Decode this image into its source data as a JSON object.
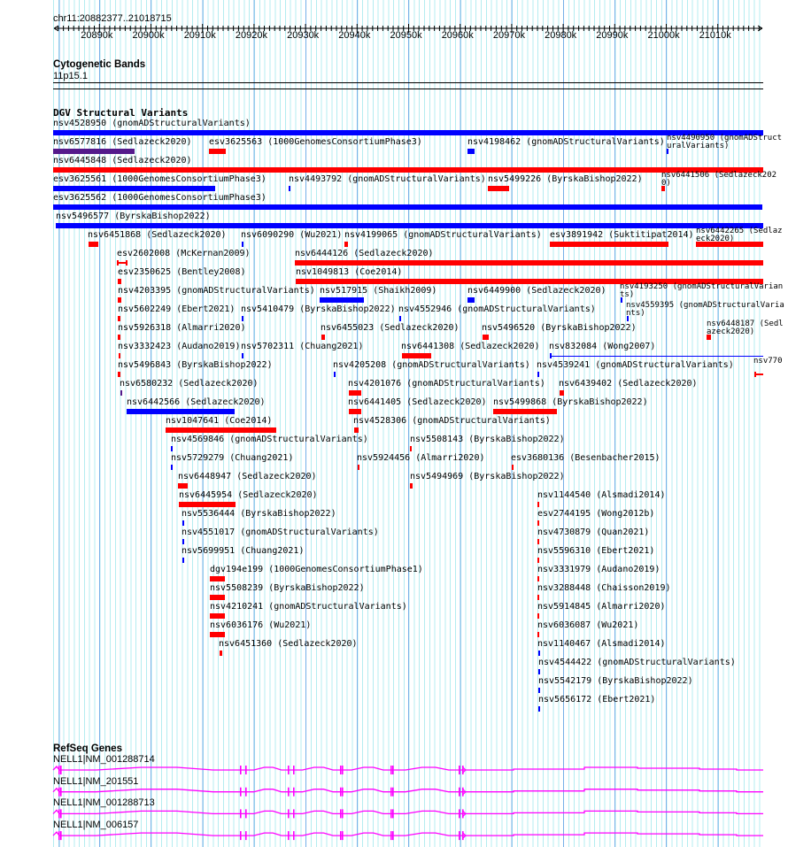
{
  "ruler": {
    "location": "chr11:20882377..21018715",
    "tick_labels": [
      "20890k",
      "20900k",
      "20910k",
      "20920k",
      "20930k",
      "20940k",
      "20950k",
      "20960k",
      "20970k",
      "20980k",
      "20990k",
      "21000k",
      "21010k"
    ]
  },
  "cytogenetic": {
    "title": "Cytogenetic Bands",
    "band": "11p15.1"
  },
  "dgv": {
    "title": "DGV Structural Variants",
    "colors": {
      "gain": "#0000ff",
      "loss": "#ff0000",
      "both": "#551a8b"
    },
    "features": [
      {
        "label": "nsv4528950 (gnomADStructuralVariants)",
        "color": "#0000ff"
      },
      {
        "label": "nsv6577816 (Sedlazeck2020)",
        "color": "#551a8b"
      },
      {
        "label": "esv3625563 (1000GenomesConsortiumPhase3)",
        "color": "#ff0000"
      },
      {
        "label": "nsv4198462 (gnomADStructuralVariants)",
        "color": "#0000ff"
      },
      {
        "label": "nsv4490950 (gnomADStructuralVariants)",
        "color": "#0000ff"
      },
      {
        "label": "nsv6445848 (Sedlazeck2020)",
        "color": "#ff0000"
      },
      {
        "label": "esv3625561 (1000GenomesConsortiumPhase3)",
        "color": "#0000ff"
      },
      {
        "label": "nsv4493792 (gnomADStructuralVariants)",
        "color": "#0000ff"
      },
      {
        "label": "nsv5499226 (ByrskaBishop2022)",
        "color": "#ff0000"
      },
      {
        "label": "nsv6441506 (Sedlazeck2020)",
        "color": "#ff0000"
      },
      {
        "label": "esv3625562 (1000GenomesConsortiumPhase3)",
        "color": "#0000ff"
      },
      {
        "label": "nsv5496577 (ByrskaBishop2022)",
        "color": "#0000ff"
      },
      {
        "label": "nsv6451868 (Sedlazeck2020)",
        "color": "#ff0000"
      },
      {
        "label": "nsv6090290 (Wu2021)",
        "color": "#0000ff"
      },
      {
        "label": "nsv4199065 (gnomADStructuralVariants)",
        "color": "#ff0000"
      },
      {
        "label": "esv3891942 (Suktitipat2014)",
        "color": "#ff0000"
      },
      {
        "label": "nsv6442265 (Sedlazeck2020)",
        "color": "#ff0000"
      },
      {
        "label": "esv2602008 (McKernan2009)",
        "color": "#ff0000"
      },
      {
        "label": "nsv6444126 (Sedlazeck2020)",
        "color": "#ff0000"
      },
      {
        "label": "esv2350625 (Bentley2008)",
        "color": "#ff0000"
      },
      {
        "label": "nsv1049813 (Coe2014)",
        "color": "#ff0000"
      },
      {
        "label": "nsv4203395 (gnomADStructuralVariants)",
        "color": "#ff0000"
      },
      {
        "label": "nsv517915 (Shaikh2009)",
        "color": "#0000ff"
      },
      {
        "label": "nsv6449900 (Sedlazeck2020)",
        "color": "#0000ff"
      },
      {
        "label": "nsv4193250 (gnomADStructuralVariants)",
        "color": "#0000ff"
      },
      {
        "label": "nsv5602249 (Ebert2021)",
        "color": "#ff0000"
      },
      {
        "label": "nsv5410479 (ByrskaBishop2022)",
        "color": "#0000ff"
      },
      {
        "label": "nsv4552946 (gnomADStructuralVariants)",
        "color": "#0000ff"
      },
      {
        "label": "nsv4559395 (gnomADStructuralVariants)",
        "color": "#0000ff"
      },
      {
        "label": "nsv5926318 (Almarri2020)",
        "color": "#ff0000"
      },
      {
        "label": "nsv6455023 (Sedlazeck2020)",
        "color": "#ff0000"
      },
      {
        "label": "nsv5496520 (ByrskaBishop2022)",
        "color": "#ff0000"
      },
      {
        "label": "nsv6448187 (Sedlazeck2020)",
        "color": "#ff0000"
      },
      {
        "label": "nsv3332423 (Audano2019)",
        "color": "#ff0000"
      },
      {
        "label": "nsv5702311 (Chuang2021)",
        "color": "#0000ff"
      },
      {
        "label": "nsv6441308 (Sedlazeck2020)",
        "color": "#ff0000"
      },
      {
        "label": "nsv832084 (Wong2007)",
        "color": "#0000ff"
      },
      {
        "label": "nsv5496843 (ByrskaBishop2022)",
        "color": "#ff0000"
      },
      {
        "label": "nsv4205208 (gnomADStructuralVariants)",
        "color": "#0000ff"
      },
      {
        "label": "nsv4539241 (gnomADStructuralVariants)",
        "color": "#0000ff"
      },
      {
        "label": "nsv770",
        "color": "#ff0000"
      },
      {
        "label": "nsv6580232 (Sedlazeck2020)",
        "color": "#551a8b"
      },
      {
        "label": "nsv4201076 (gnomADStructuralVariants)",
        "color": "#ff0000"
      },
      {
        "label": "nsv6439402 (Sedlazeck2020)",
        "color": "#ff0000"
      },
      {
        "label": "nsv6442566 (Sedlazeck2020)",
        "color": "#0000ff"
      },
      {
        "label": "nsv6441405 (Sedlazeck2020)",
        "color": "#ff0000"
      },
      {
        "label": "nsv5499868 (ByrskaBishop2022)",
        "color": "#ff0000"
      },
      {
        "label": "nsv1047641 (Coe2014)",
        "color": "#ff0000"
      },
      {
        "label": "nsv4528306 (gnomADStructuralVariants)",
        "color": "#ff0000"
      },
      {
        "label": "nsv4569846 (gnomADStructuralVariants)",
        "color": "#0000ff"
      },
      {
        "label": "nsv5508143 (ByrskaBishop2022)",
        "color": "#ff0000"
      },
      {
        "label": "nsv5729279 (Chuang2021)",
        "color": "#0000ff"
      },
      {
        "label": "nsv5924456 (Almarri2020)",
        "color": "#ff0000"
      },
      {
        "label": "esv3680136 (Besenbacher2015)",
        "color": "#ff0000"
      },
      {
        "label": "nsv6448947 (Sedlazeck2020)",
        "color": "#ff0000"
      },
      {
        "label": "nsv5494969 (ByrskaBishop2022)",
        "color": "#ff0000"
      },
      {
        "label": "nsv6445954 (Sedlazeck2020)",
        "color": "#ff0000"
      },
      {
        "label": "nsv1144540 (Alsmadi2014)",
        "color": "#ff0000"
      },
      {
        "label": "nsv5536444 (ByrskaBishop2022)",
        "color": "#0000ff"
      },
      {
        "label": "esv2744195 (Wong2012b)",
        "color": "#ff0000"
      },
      {
        "label": "nsv4551017 (gnomADStructuralVariants)",
        "color": "#0000ff"
      },
      {
        "label": "nsv4730879 (Quan2021)",
        "color": "#ff0000"
      },
      {
        "label": "nsv5699951 (Chuang2021)",
        "color": "#0000ff"
      },
      {
        "label": "nsv5596310 (Ebert2021)",
        "color": "#ff0000"
      },
      {
        "label": "dgv194e199 (1000GenomesConsortiumPhase1)",
        "color": "#ff0000"
      },
      {
        "label": "nsv3331979 (Audano2019)",
        "color": "#ff0000"
      },
      {
        "label": "nsv5508239 (ByrskaBishop2022)",
        "color": "#ff0000"
      },
      {
        "label": "nsv3288448 (Chaisson2019)",
        "color": "#ff0000"
      },
      {
        "label": "nsv4210241 (gnomADStructuralVariants)",
        "color": "#ff0000"
      },
      {
        "label": "nsv5914845 (Almarri2020)",
        "color": "#ff0000"
      },
      {
        "label": "nsv6036176 (Wu2021)",
        "color": "#ff0000"
      },
      {
        "label": "nsv6036087 (Wu2021)",
        "color": "#ff0000"
      },
      {
        "label": "nsv6451360 (Sedlazeck2020)",
        "color": "#ff0000"
      },
      {
        "label": "nsv1140467 (Alsmadi2014)",
        "color": "#0000ff"
      },
      {
        "label": "nsv4544422 (gnomADStructuralVariants)",
        "color": "#0000ff"
      },
      {
        "label": "nsv5542179 (ByrskaBishop2022)",
        "color": "#0000ff"
      },
      {
        "label": "nsv5656172 (Ebert2021)",
        "color": "#0000ff"
      }
    ]
  },
  "refseq": {
    "title": "RefSeq Genes",
    "color": "#ff00ff",
    "transcripts": [
      {
        "label": "NELL1|NM_001288714"
      },
      {
        "label": "NELL1|NM_201551"
      },
      {
        "label": "NELL1|NM_001288713"
      },
      {
        "label": "NELL1|NM_006157"
      }
    ]
  }
}
